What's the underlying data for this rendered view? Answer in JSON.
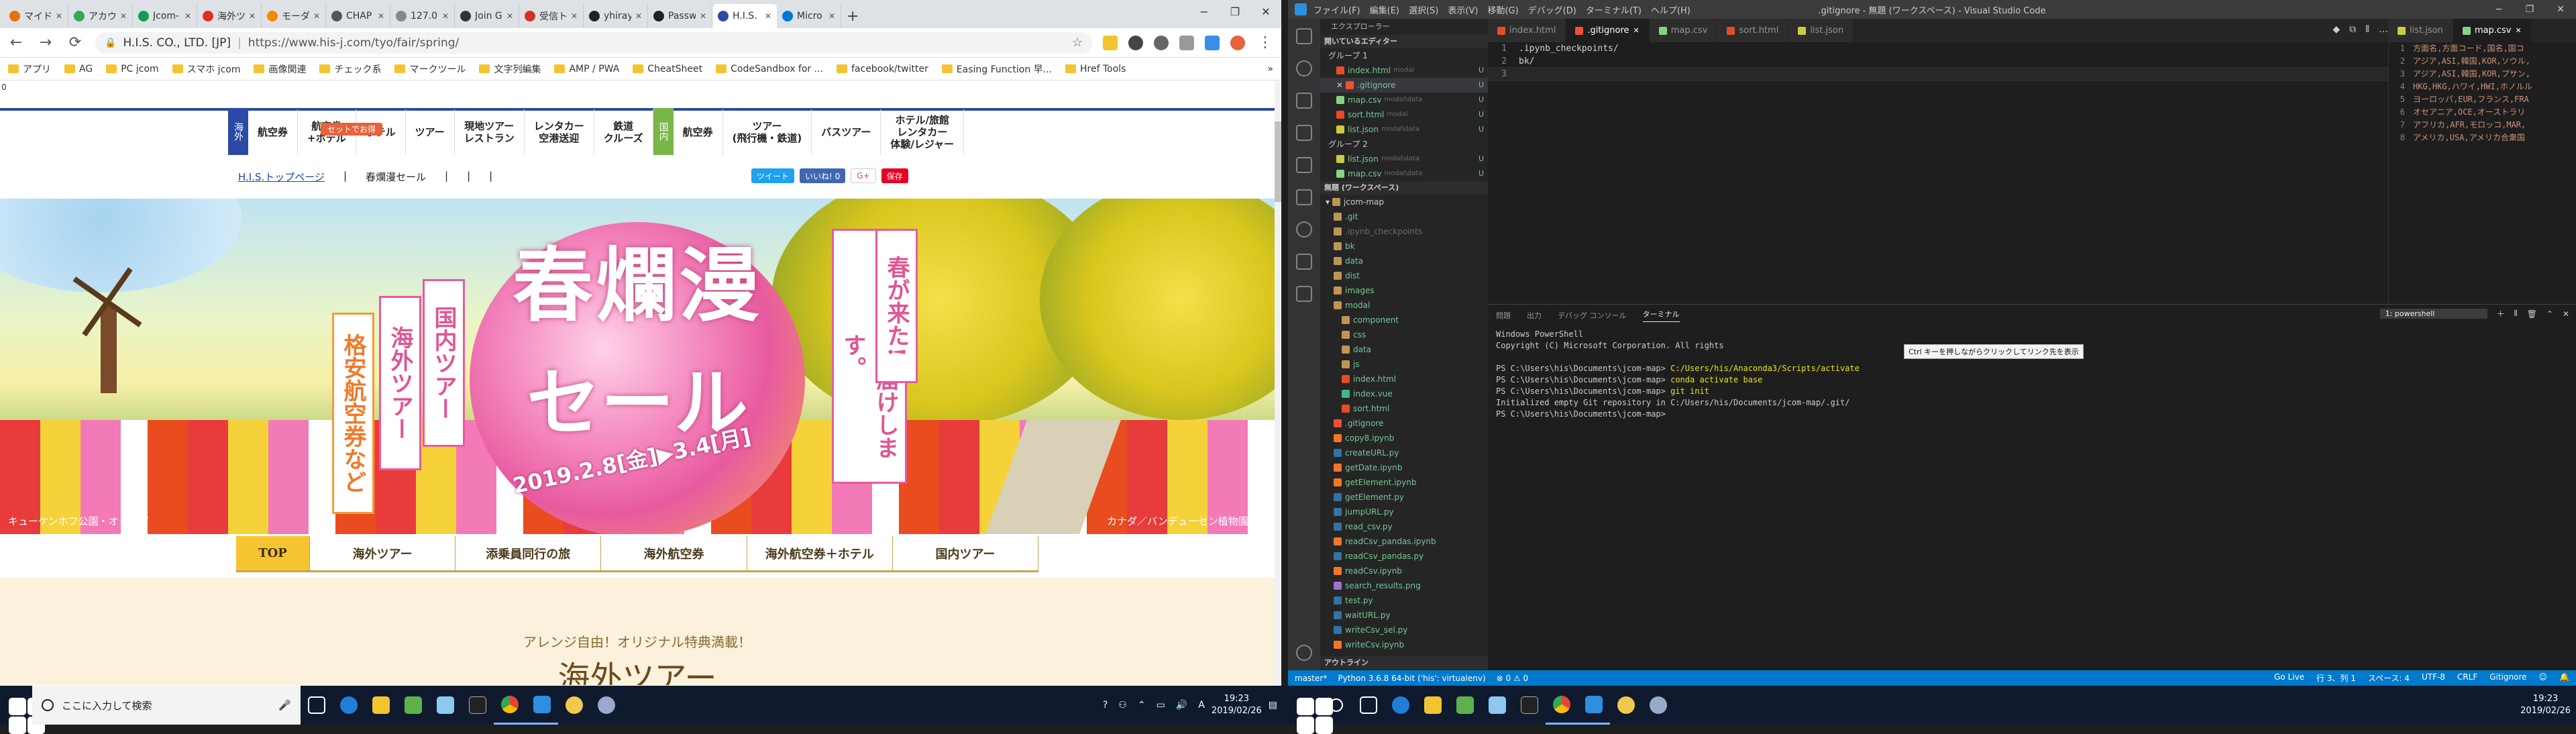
{
  "chrome": {
    "tabs": [
      {
        "label": "マイド",
        "color": "#e37400"
      },
      {
        "label": "アカウ",
        "color": "#34a853"
      },
      {
        "label": "Jcom-",
        "color": "#0f9d58"
      },
      {
        "label": "海外ツ",
        "color": "#d93025"
      },
      {
        "label": "モーダ",
        "color": "#f28b00"
      },
      {
        "label": "CHAP",
        "color": "#555555"
      },
      {
        "label": "127.0.",
        "color": "#888888"
      },
      {
        "label": "Join G",
        "color": "#333333"
      },
      {
        "label": "受信ト",
        "color": "#d93025"
      },
      {
        "label": "yhiray",
        "color": "#222222"
      },
      {
        "label": "Passw",
        "color": "#222222"
      },
      {
        "label": "H.I.S.",
        "color": "#2b4aa6"
      },
      {
        "label": "Micro",
        "color": "#0078d4"
      }
    ],
    "new_tab": "+",
    "win_controls": [
      "−",
      "❐",
      "✕"
    ],
    "url_org": "H.I.S. CO., LTD. [JP]",
    "url": "https://www.his-j.com/tyo/fair/spring/",
    "bookmarks": [
      "アプリ",
      "AG",
      "PC jcom",
      "スマホ jcom",
      "画像関連",
      "チェック系",
      "マークツール",
      "文字列編集",
      "AMP / PWA",
      "CheatSheet",
      "CodeSandbox for ...",
      "facebook/twitter",
      "Easing Function 早...",
      "Href Tools"
    ],
    "bookmarks_more": "»"
  },
  "site": {
    "logo": "海外",
    "nav": [
      "航空券",
      "航空券\n+ホテル",
      "ホテル",
      "ツアー",
      "現地ツアー\nレストラン",
      "レンタカー\n空港送迎",
      "鉄道\nクルーズ"
    ],
    "domestic": "国内",
    "nav_dom": [
      "航空券",
      "ツアー\n(飛行機・鉄道)",
      "バスツアー",
      "ホテル/旅館\nレンタカー\n体験/レジャー"
    ],
    "tag": "セットでお得",
    "breadcrumb_home": "H.I.S.トップページ",
    "breadcrumb_current": "春爛漫セール",
    "social": [
      "ツイート",
      "いいね! 0",
      "G+",
      "保存"
    ],
    "hero_title": "春爛漫",
    "hero_sub": "セール",
    "hero_date": "2019.2.8[金]▶3.4[月]",
    "banner1": "国内ツアー",
    "banner2": "海外ツアー",
    "banner3": "格安航空券など",
    "banner4": "旬な旅をお届けします。",
    "banner5": "春が来た!",
    "cap_left": "キューケンホフ公園・オランダ",
    "cap_right": "カナダ／バンデューセン植物園",
    "tabs": [
      "TOP",
      "海外ツアー",
      "添乗員同行の旅",
      "海外航空券",
      "海外航空券＋ホテル",
      "国内ツアー"
    ],
    "body_sub": "アレンジ自由！オリジナル特典満載！",
    "body_title": "海外ツアー"
  },
  "vscode": {
    "window_title": ".gitignore - 無題 (ワークスペース) - Visual Studio Code",
    "menu": [
      "ファイル(F)",
      "編集(E)",
      "選択(S)",
      "表示(V)",
      "移動(G)",
      "デバッグ(D)",
      "ターミナル(T)",
      "ヘルプ(H)"
    ],
    "explorer_title": "エクスプローラー",
    "open_editors": "開いているエディター",
    "group1": "グループ 1",
    "group2": "グループ 2",
    "open_items_g1": [
      {
        "name": "index.html",
        "path": "modal",
        "status": "U",
        "color": "#e44d26"
      },
      {
        "name": ".gitignore",
        "path": "",
        "status": "U",
        "color": "#f05133",
        "active": true
      },
      {
        "name": "map.csv",
        "path": "modal\\data",
        "status": "U",
        "color": "#89d185"
      },
      {
        "name": "sort.html",
        "path": "modal",
        "status": "U",
        "color": "#e44d26"
      },
      {
        "name": "list.json",
        "path": "modal\\data",
        "status": "U",
        "color": "#cbcb41"
      }
    ],
    "open_items_g2": [
      {
        "name": "list.json",
        "path": "modal\\data",
        "status": "U",
        "color": "#cbcb41"
      },
      {
        "name": "map.csv",
        "path": "modal\\data",
        "status": "U",
        "color": "#89d185"
      }
    ],
    "workspace": "無題 (ワークスペース)",
    "root_folder": "jcom-map",
    "tree": [
      {
        "name": ".git",
        "indent": 1,
        "color": "#c09553"
      },
      {
        "name": ".ipynb_checkpoints",
        "indent": 1,
        "color": "#c09553",
        "dim": true
      },
      {
        "name": "bk",
        "indent": 1,
        "color": "#c09553"
      },
      {
        "name": "data",
        "indent": 1,
        "color": "#c09553"
      },
      {
        "name": "dist",
        "indent": 1,
        "color": "#c09553"
      },
      {
        "name": "images",
        "indent": 1,
        "color": "#c09553"
      },
      {
        "name": "modal",
        "indent": 1,
        "color": "#c09553"
      },
      {
        "name": "component",
        "indent": 2,
        "color": "#c09553"
      },
      {
        "name": "css",
        "indent": 2,
        "color": "#c09553"
      },
      {
        "name": "data",
        "indent": 2,
        "color": "#c09553"
      },
      {
        "name": "js",
        "indent": 2,
        "color": "#c09553"
      },
      {
        "name": "index.html",
        "indent": 2,
        "color": "#e44d26"
      },
      {
        "name": "index.vue",
        "indent": 2,
        "color": "#41b883"
      },
      {
        "name": "sort.html",
        "indent": 2,
        "color": "#e44d26"
      },
      {
        "name": ".gitignore",
        "indent": 1,
        "color": "#f05133"
      },
      {
        "name": "copy8.ipynb",
        "indent": 1,
        "color": "#f37626"
      },
      {
        "name": "createURL.py",
        "indent": 1,
        "color": "#3572a5"
      },
      {
        "name": "getDate.ipynb",
        "indent": 1,
        "color": "#f37626"
      },
      {
        "name": "getElement.ipynb",
        "indent": 1,
        "color": "#f37626"
      },
      {
        "name": "getElement.py",
        "indent": 1,
        "color": "#3572a5"
      },
      {
        "name": "jumpURL.py",
        "indent": 1,
        "color": "#3572a5"
      },
      {
        "name": "read_csv.py",
        "indent": 1,
        "color": "#3572a5"
      },
      {
        "name": "readCsv_pandas.ipynb",
        "indent": 1,
        "color": "#f37626"
      },
      {
        "name": "readCsv_pandas.py",
        "indent": 1,
        "color": "#3572a5"
      },
      {
        "name": "readCsv.ipynb",
        "indent": 1,
        "color": "#f37626"
      },
      {
        "name": "search_results.png",
        "indent": 1,
        "color": "#a074c4"
      },
      {
        "name": "test.py",
        "indent": 1,
        "color": "#3572a5"
      },
      {
        "name": "waitURL.py",
        "indent": 1,
        "color": "#3572a5"
      },
      {
        "name": "writeCsv_sel.py",
        "indent": 1,
        "color": "#3572a5"
      },
      {
        "name": "writeCsv.ipynb",
        "indent": 1,
        "color": "#f37626"
      }
    ],
    "outline": "アウトライン",
    "editor_tabs": [
      {
        "name": "index.html",
        "color": "#e44d26"
      },
      {
        "name": ".gitignore",
        "color": "#f05133",
        "active": true
      },
      {
        "name": "map.csv",
        "color": "#89d185"
      },
      {
        "name": "sort.html",
        "color": "#e44d26"
      },
      {
        "name": "list.json",
        "color": "#cbcb41"
      }
    ],
    "editor_lines": [
      ".ipynb_checkpoints/",
      "bk/",
      ""
    ],
    "editor2_tabs": [
      {
        "name": "list.json",
        "color": "#cbcb41"
      },
      {
        "name": "map.csv",
        "color": "#89d185",
        "active": true
      }
    ],
    "editor2_lines": [
      "方面名,方面コード,国名,国コ",
      "アジア,ASI,韓国,KOR,ソウル,",
      "アジア,ASI,韓国,KOR,プサン,",
      "HKG,HKG,ハワイ,HWI,ホノルル",
      "ヨーロッパ,EUR,フランス,FRA",
      "オセアニア,OCE,オーストラリ",
      "アフリカ,AFR,モロッコ,MAR,",
      "アメリカ,USA,アメリカ合衆国"
    ],
    "panel_tabs": [
      "問題",
      "出力",
      "デバッグ コンソール",
      "ターミナル"
    ],
    "panel_select": "1: powershell",
    "terminal": [
      {
        "text": "Windows PowerShell"
      },
      {
        "text": "Copyright (C) Microsoft Corporation. All rights"
      },
      {
        "text": ""
      },
      {
        "text": "PS C:\\Users\\his\\Documents\\jcom-map> ",
        "hi": "C:/Users/his/Anaconda3/Scripts/activate"
      },
      {
        "text": "PS C:\\Users\\his\\Documents\\jcom-map> ",
        "hi": "conda activate base"
      },
      {
        "text": "PS C:\\Users\\his\\Documents\\jcom-map> ",
        "hi": "git init"
      },
      {
        "text": "Initialized empty Git repository in C:/Users/his/Documents/jcom-map/.git/"
      },
      {
        "text": "PS C:\\Users\\his\\Documents\\jcom-map> "
      }
    ],
    "tooltip": "Ctrl キーを押しながらクリックしてリンク先を表示",
    "status_left": [
      "master*",
      "Python 3.6.8 64-bit ('his': virtualenv)",
      "⊗ 0 ⚠ 0"
    ],
    "status_right": [
      "Go Live",
      "行 3、列 1",
      "スペース: 4",
      "UTF-8",
      "CRLF",
      "Gitignore",
      "☺",
      "🔔"
    ]
  },
  "taskbar": {
    "search_placeholder": "ここに入力して検索",
    "clock_time": "19:23",
    "clock_date": "2019/02/26",
    "clock_time2": "19:23",
    "clock_date2": "2019/02/26",
    "ime": "A"
  }
}
